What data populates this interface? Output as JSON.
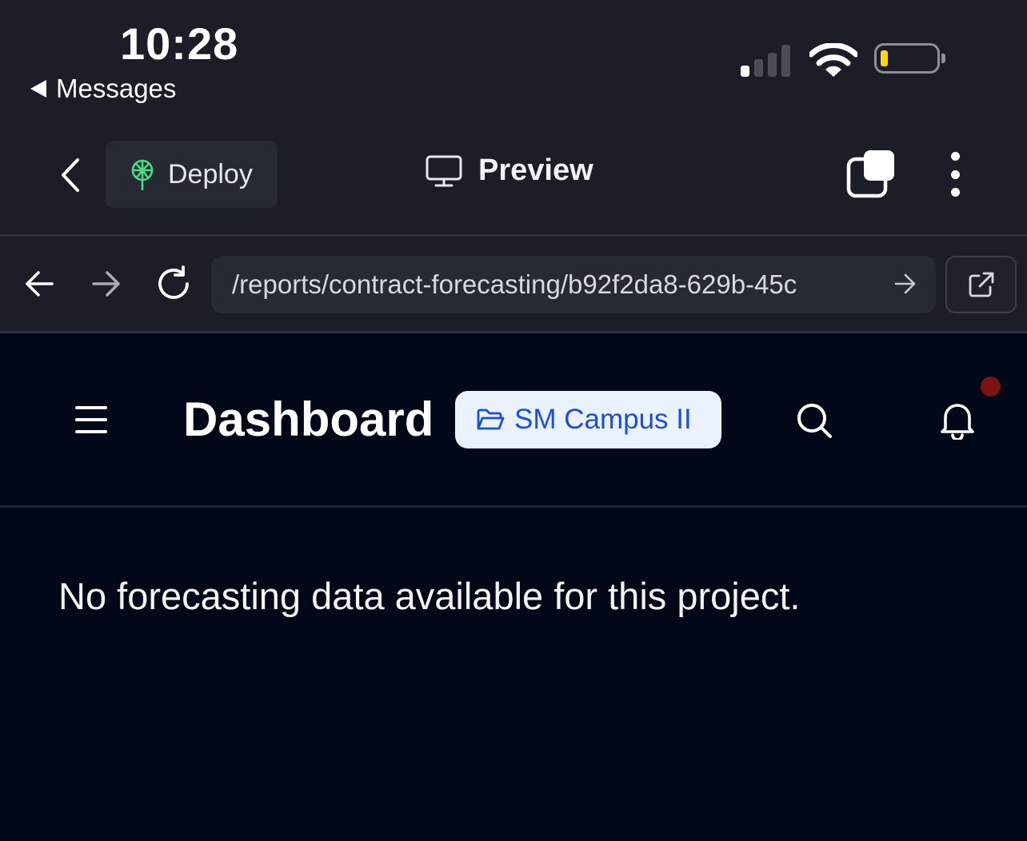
{
  "status_bar": {
    "time": "10:28",
    "back_app": "Messages"
  },
  "toolbar": {
    "deploy_label": "Deploy",
    "preview_label": "Preview"
  },
  "address_bar": {
    "url": "/reports/contract-forecasting/b92f2da8-629b-45c"
  },
  "app_header": {
    "title": "Dashboard",
    "project": "SM Campus II"
  },
  "main": {
    "empty_message": "No forecasting data available for this project."
  },
  "colors": {
    "chrome_bg": "#1b1e27",
    "page_bg": "#020817",
    "project_chip_bg": "#eaf2ff",
    "project_chip_text": "#1d4ed8",
    "deploy_icon": "#4ade80",
    "battery_level": "#ffd60a",
    "notification_dot": "#7a1414"
  },
  "icons": {
    "back": "chevron-left-icon",
    "deploy": "deploy-icon",
    "preview": "monitor-icon",
    "tabs": "tabs-icon",
    "more": "more-vertical-icon",
    "nav_back": "arrow-left-icon",
    "nav_forward": "arrow-right-icon",
    "reload": "reload-icon",
    "go": "arrow-right-icon",
    "open_external": "external-link-icon",
    "menu": "hamburger-icon",
    "project": "folder-open-icon",
    "search": "search-icon",
    "notifications": "bell-icon"
  },
  "battery": {
    "level": 0.1
  },
  "signal": {
    "bars": 1,
    "of": 4
  }
}
